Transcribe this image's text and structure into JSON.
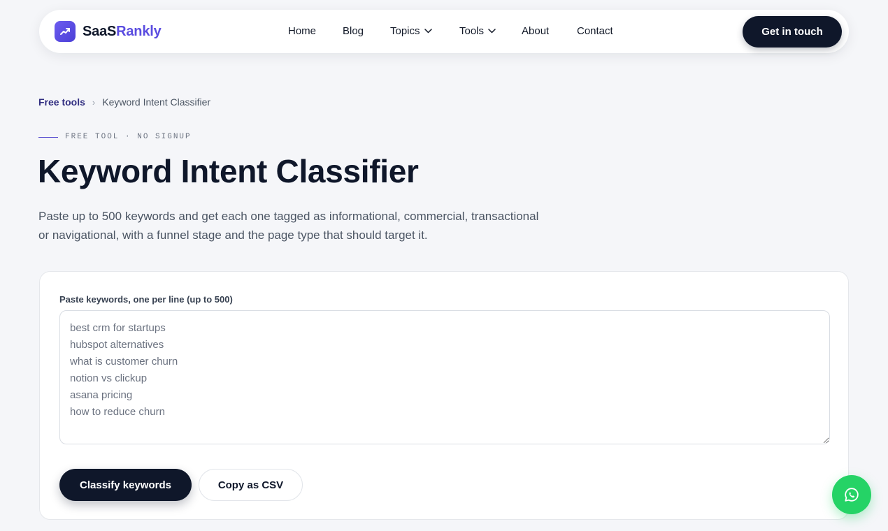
{
  "brand": {
    "part1": "SaaS",
    "part2": "Rankly",
    "icon": "trending-up-icon",
    "accent": "#5b4de0"
  },
  "nav": {
    "items": [
      {
        "label": "Home",
        "has_dropdown": false
      },
      {
        "label": "Blog",
        "has_dropdown": false
      },
      {
        "label": "Topics",
        "has_dropdown": true
      },
      {
        "label": "Tools",
        "has_dropdown": true
      },
      {
        "label": "About",
        "has_dropdown": false
      },
      {
        "label": "Contact",
        "has_dropdown": false
      }
    ],
    "cta_label": "Get in touch"
  },
  "breadcrumb": {
    "parent": "Free tools",
    "separator": "›",
    "current": "Keyword Intent Classifier"
  },
  "eyebrow": "FREE TOOL · NO SIGNUP",
  "page": {
    "title": "Keyword Intent Classifier",
    "description": "Paste up to 500 keywords and get each one tagged as informational, commercial, transactional or navigational, with a funnel stage and the page type that should target it."
  },
  "form": {
    "label": "Paste keywords, one per line (up to 500)",
    "placeholder": "best crm for startups\nhubspot alternatives\nwhat is customer churn\nnotion vs clickup\nasana pricing\nhow to reduce churn",
    "primary_button": "Classify keywords",
    "secondary_button": "Copy as CSV"
  },
  "floating": {
    "icon": "whatsapp-icon",
    "color": "#25d366"
  }
}
